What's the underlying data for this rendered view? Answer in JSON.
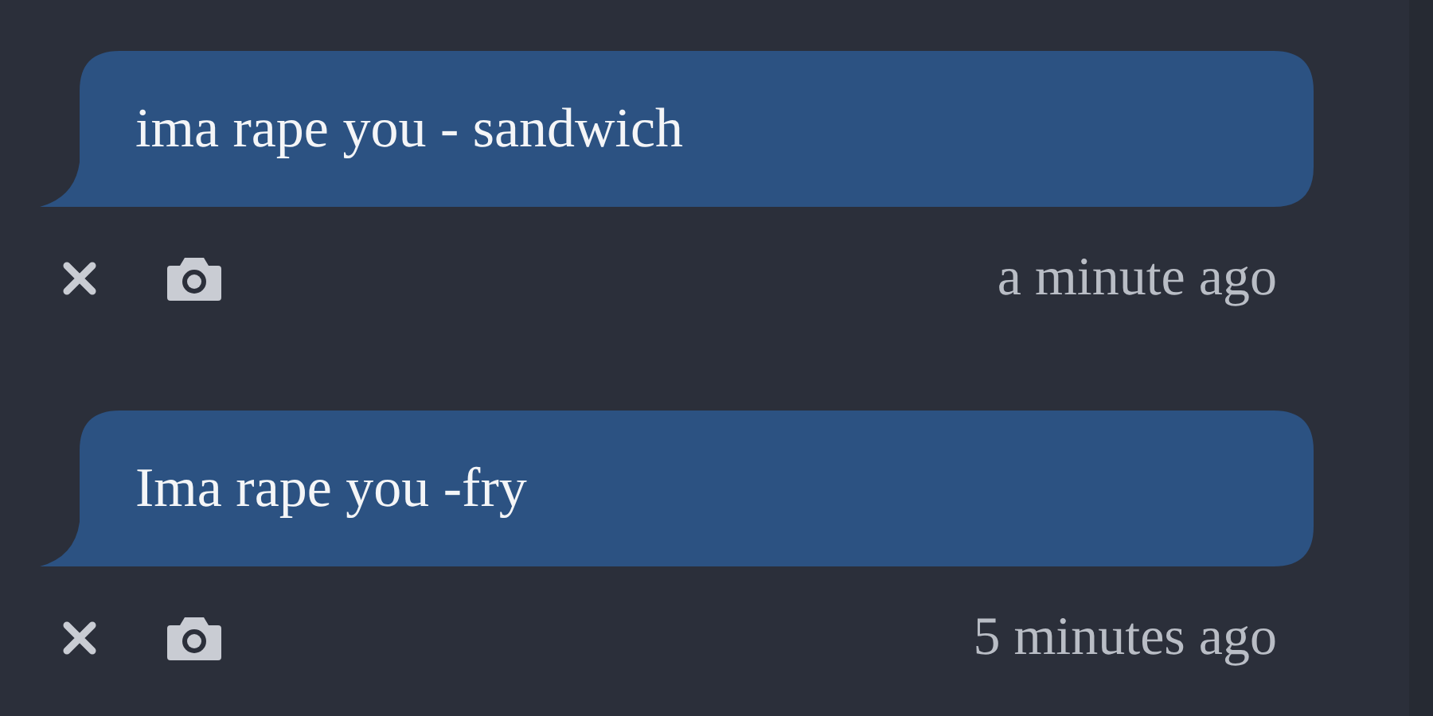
{
  "messages": [
    {
      "text": "ima rape you - sandwich",
      "time": "a minute ago"
    },
    {
      "text": "Ima rape you -fry",
      "time": "5 minutes ago"
    }
  ]
}
